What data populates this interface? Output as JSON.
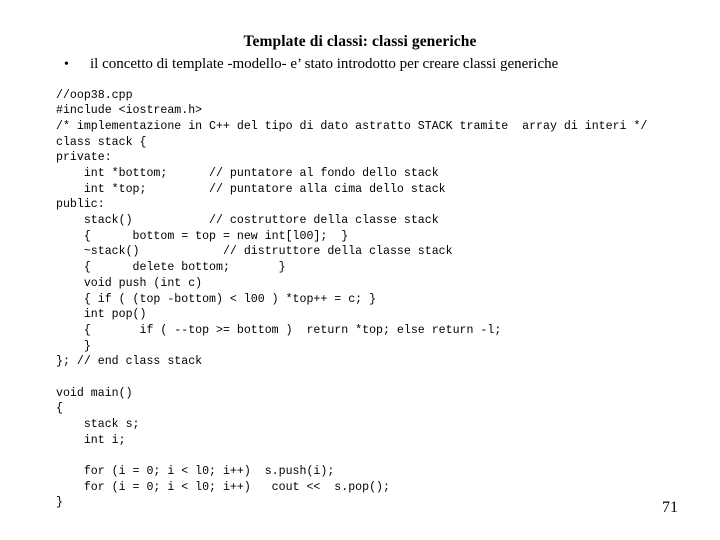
{
  "slide": {
    "title": "Template di classi: classi generiche",
    "bullet": {
      "marker": "•",
      "text": "il concetto di template -modello- e’ stato introdotto per creare classi generiche"
    },
    "page_number": "71",
    "background_color": "#ffffff",
    "text_color": "#000000"
  },
  "code": {
    "lines": [
      "//oop38.cpp",
      "#include <iostream.h>",
      "/* implementazione in C++ del tipo di dato astratto STACK tramite  array di interi */",
      "class stack {",
      "private:",
      "    int *bottom;      // puntatore al fondo dello stack",
      "    int *top;         // puntatore alla cima dello stack",
      "public:",
      "    stack()           // costruttore della classe stack",
      "    {      bottom = top = new int[l00];  }",
      "    ~stack()            // distruttore della classe stack",
      "    {      delete bottom;       }",
      "    void push (int c)",
      "    { if ( (top -bottom) < l00 ) *top++ = c; }",
      "    int pop()",
      "    {       if ( --top >= bottom )  return *top; else return -l;",
      "    }",
      "}; // end class stack",
      "",
      "void main()",
      "{",
      "    stack s;",
      "    int i;",
      "",
      "    for (i = 0; i < l0; i++)  s.push(i);",
      "    for (i = 0; i < l0; i++)   cout <<  s.pop();",
      "}"
    ],
    "squeeze_line_index": 2
  }
}
